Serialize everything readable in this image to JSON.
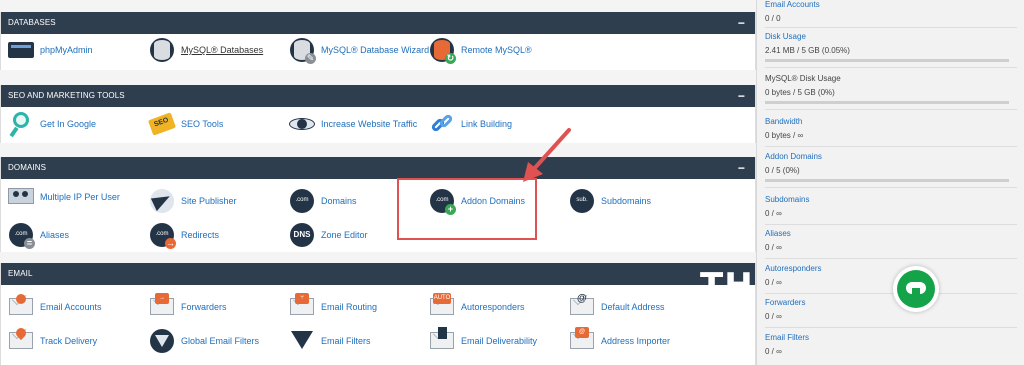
{
  "sections": {
    "databases": {
      "title": "DATABASES",
      "toggle": "−",
      "items": [
        {
          "label": "phpMyAdmin",
          "icon": "phpmyadmin-icon"
        },
        {
          "label": "MySQL® Databases",
          "icon": "mysql-databases-icon"
        },
        {
          "label": "MySQL® Database Wizard",
          "icon": "mysql-wizard-icon"
        },
        {
          "label": "Remote MySQL®",
          "icon": "remote-mysql-icon"
        }
      ]
    },
    "seo": {
      "title": "SEO AND MARKETING TOOLS",
      "toggle": "−",
      "items": [
        {
          "label": "Get In Google",
          "icon": "magnifier-icon"
        },
        {
          "label": "SEO Tools",
          "icon": "seo-tag-icon"
        },
        {
          "label": "Increase Website Traffic",
          "icon": "eye-icon"
        },
        {
          "label": "Link Building",
          "icon": "chain-link-icon"
        }
      ]
    },
    "domains": {
      "title": "DOMAINS",
      "toggle": "−",
      "items": [
        {
          "label": "Multiple IP Per User",
          "icon": "multiple-ip-icon"
        },
        {
          "label": "Site Publisher",
          "icon": "paper-plane-icon"
        },
        {
          "label": "Domains",
          "icon": "domains-icon",
          "text": ".com"
        },
        {
          "label": "Addon Domains",
          "icon": "addon-domains-icon",
          "text": ".com"
        },
        {
          "label": "Subdomains",
          "icon": "subdomains-icon",
          "text": "sub."
        },
        {
          "label": "Aliases",
          "icon": "aliases-icon",
          "text": ".com"
        },
        {
          "label": "Redirects",
          "icon": "redirects-icon",
          "text": ".com"
        },
        {
          "label": "Zone Editor",
          "icon": "dns-icon",
          "text": "DNS"
        }
      ]
    },
    "email": {
      "title": "EMAIL",
      "items": [
        {
          "label": "Email Accounts",
          "icon": "email-accounts-icon"
        },
        {
          "label": "Forwarders",
          "icon": "forwarders-icon"
        },
        {
          "label": "Email Routing",
          "icon": "email-routing-icon"
        },
        {
          "label": "Autoresponders",
          "icon": "autoresponders-icon",
          "text": "AUTO"
        },
        {
          "label": "Default Address",
          "icon": "default-address-icon",
          "text": "@"
        },
        {
          "label": "Track Delivery",
          "icon": "track-delivery-icon"
        },
        {
          "label": "Global Email Filters",
          "icon": "global-filter-icon"
        },
        {
          "label": "Email Filters",
          "icon": "email-filter-icon"
        },
        {
          "label": "Email Deliverability",
          "icon": "email-deliverability-icon"
        },
        {
          "label": "Address Importer",
          "icon": "address-importer-icon"
        }
      ]
    }
  },
  "stats": [
    {
      "title": "Email Accounts",
      "value": "0 / 0",
      "bar": false
    },
    {
      "title": "Disk Usage",
      "value": "2.41 MB / 5 GB   (0.05%)",
      "bar": true,
      "fill_percent": 0.05
    },
    {
      "title": "MySQL® Disk Usage",
      "value": "0 bytes / 5 GB   (0%)",
      "bar": true,
      "fill_percent": 0
    },
    {
      "title": "Bandwidth",
      "value": "0 bytes / ∞",
      "bar": false
    },
    {
      "title": "Addon Domains",
      "value": "0 / 5   (0%)",
      "bar": true,
      "fill_percent": 0
    },
    {
      "title": "Subdomains",
      "value": "0 / ∞",
      "bar": false
    },
    {
      "title": "Aliases",
      "value": "0 / ∞",
      "bar": false
    },
    {
      "title": "Autoresponders",
      "value": "0 / ∞",
      "bar": false
    },
    {
      "title": "Forwarders",
      "value": "0 / ∞",
      "bar": false
    },
    {
      "title": "Email Filters",
      "value": "0 / ∞",
      "bar": false
    }
  ],
  "watermark": "TH",
  "colors": {
    "header_bg": "#2f3e4e",
    "link": "#1f6fbd",
    "annotation": "#e05252",
    "float_button": "#15a34a"
  }
}
